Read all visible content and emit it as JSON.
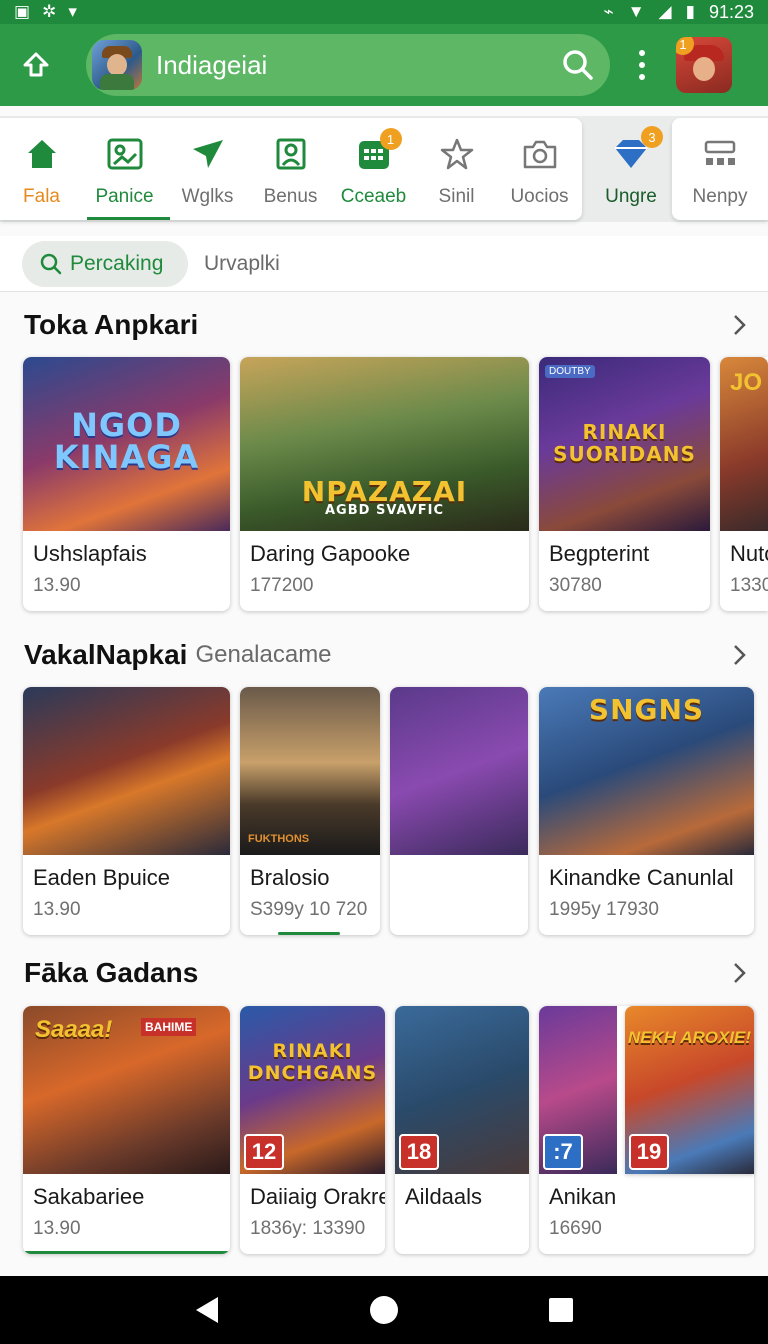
{
  "status_bar": {
    "time": "91:23"
  },
  "app_bar": {
    "title": "Indiageiai",
    "profile_badge": "1"
  },
  "tabs": [
    {
      "label": "Fala",
      "icon": "home-icon"
    },
    {
      "label": "Panice",
      "icon": "image-frame-icon"
    },
    {
      "label": "Wglks",
      "icon": "send-icon"
    },
    {
      "label": "Benus",
      "icon": "portrait-icon"
    },
    {
      "label": "Cceaeb",
      "icon": "calendar-icon",
      "badge": "1"
    },
    {
      "label": "Sinil",
      "icon": "star-icon"
    },
    {
      "label": "Uocios",
      "icon": "camera-icon"
    },
    {
      "label": "Ungre",
      "icon": "diamond-icon",
      "badge": "3"
    },
    {
      "label": "Nenpy",
      "icon": "grid-icon"
    }
  ],
  "filter": {
    "chip_label": "Percaking",
    "secondary": "Urvaplki"
  },
  "sections": [
    {
      "title": "Toka Anpkari",
      "subtitle": "",
      "cards": [
        {
          "name": "Ushslapfais",
          "meta": "13.90",
          "art_title": "NGOD KINAGA"
        },
        {
          "name": "Daring Gapooke",
          "meta": "177200",
          "art_title": "NPAZAZAI",
          "art_subtitle": "AGBD SVAVFIC"
        },
        {
          "name": "Begpterint",
          "meta": "30780",
          "art_title": "RINAKI SUORIDANS",
          "art_tag": "DOUTBY"
        },
        {
          "name": "Nutc",
          "meta": "1330",
          "art_title": "JO"
        }
      ]
    },
    {
      "title": "VakalNapkai",
      "subtitle": "Genalacame",
      "cards": [
        {
          "name": "Eaden Bpuice",
          "meta": "13.90"
        },
        {
          "name": "Bralosio",
          "meta": "S399y 10 720",
          "art_title": "FUKTHONS"
        },
        {
          "name": "",
          "meta": ""
        },
        {
          "name": "Kinandke Canunlal",
          "meta": "1995y 17930",
          "art_title": "SNGNS"
        }
      ]
    },
    {
      "title": "Fāka Gadans",
      "subtitle": "",
      "cards": [
        {
          "name": "Sakabariee",
          "meta": "13.90",
          "art_title": "Saaaa!",
          "art_tag": "BAHIME"
        },
        {
          "name": "Daiiaig Orakrel",
          "meta": "1836y: 13390",
          "art_title": "RINAKI DNCHGANS",
          "age": "12"
        },
        {
          "name": "Aildaals",
          "meta": "",
          "age": "18"
        },
        {
          "name": "Anikan",
          "meta": "16690",
          "age": ":7"
        },
        {
          "name": "",
          "meta": "",
          "art_title": "NEKH AROXIE!",
          "age": "19"
        }
      ]
    }
  ],
  "colors": {
    "primary": "#2c9a46",
    "accent": "#f0a020",
    "home": "#e68a1e"
  }
}
